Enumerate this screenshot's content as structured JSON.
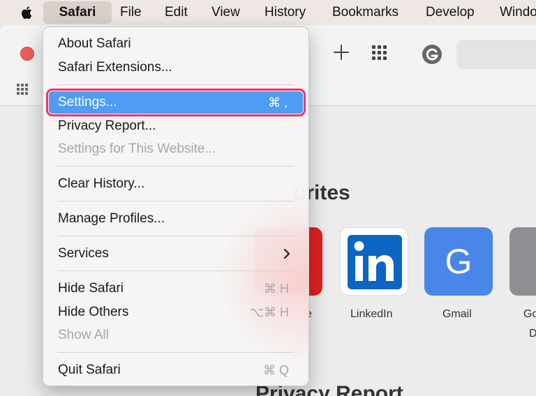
{
  "menubar": {
    "apple_icon": "apple-logo-icon",
    "items": [
      "Safari",
      "File",
      "Edit",
      "View",
      "History",
      "Bookmarks",
      "Develop",
      "Windo"
    ]
  },
  "toolbar": {
    "close_color": "#ee5d57",
    "icons": [
      "plus-icon",
      "grid-icon",
      "g-extension-icon",
      "favorites-grid-icon"
    ]
  },
  "content": {
    "favourites_title": "urites",
    "privacy_title": "Privacy Report",
    "favourites": [
      {
        "label": "e",
        "color": "#e02020"
      },
      {
        "label": "LinkedIn",
        "color": "#0a66c2"
      },
      {
        "label": "Gmail",
        "color": "#4a86e8",
        "letter": "G"
      },
      {
        "label": "Go",
        "sublabel": "D",
        "color": "#8e8e93"
      }
    ]
  },
  "menu": {
    "items": [
      {
        "label": "About Safari"
      },
      {
        "label": "Safari Extensions..."
      },
      {
        "label": "Settings...",
        "shortcut": "⌘ ,",
        "selected": true
      },
      {
        "label": "Privacy Report..."
      },
      {
        "label": "Settings for This Website...",
        "disabled": true
      },
      {
        "label": "Clear History..."
      },
      {
        "label": "Manage Profiles..."
      },
      {
        "label": "Services",
        "submenu": true
      },
      {
        "label": "Hide Safari",
        "shortcut": "⌘ H"
      },
      {
        "label": "Hide Others",
        "shortcut": "⌥⌘ H"
      },
      {
        "label": "Show All",
        "disabled": true
      },
      {
        "label": "Quit Safari",
        "shortcut": "⌘ Q"
      }
    ],
    "highlight_color": "#4f9cf5",
    "annotation_color": "#f0336b"
  }
}
